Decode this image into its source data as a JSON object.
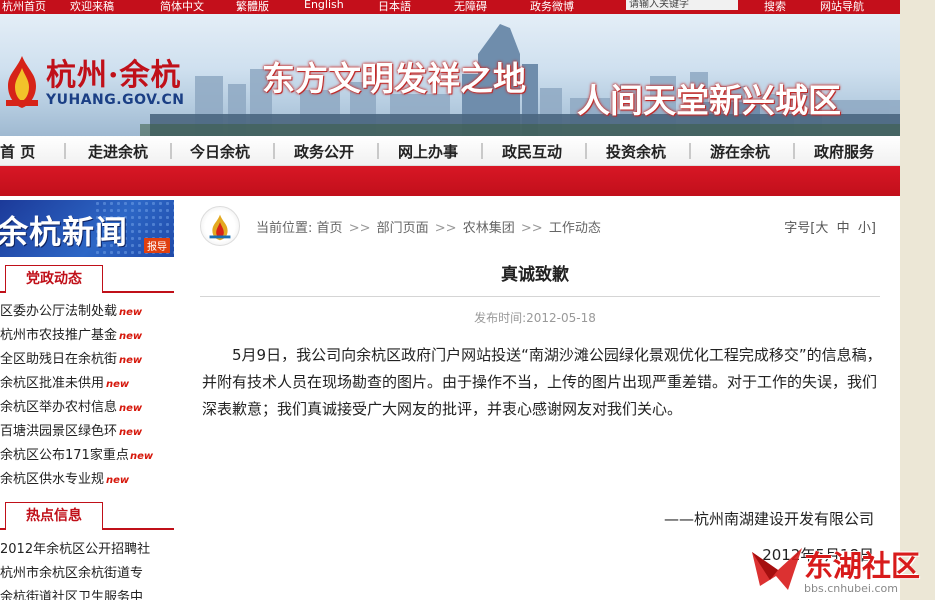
{
  "topbar": {
    "items": [
      "杭州首页",
      "欢迎来稿",
      "简体中文",
      "繁體版",
      "English",
      "日本語",
      "无障碍",
      "政务微博"
    ],
    "search_placeholder": "请输入关键字",
    "right_items": [
      "搜索",
      "网站导航"
    ]
  },
  "banner": {
    "logo_title": "杭州·余杭",
    "logo_sub": "YUHANG.GOV.CN",
    "slogan_1": "东方文明发祥之地",
    "slogan_2": "人间天堂新兴城区"
  },
  "nav": {
    "items": [
      "首 页",
      "走进余杭",
      "今日余杭",
      "政务公开",
      "网上办事",
      "政民互动",
      "投资余杭",
      "游在余杭",
      "政府服务"
    ]
  },
  "sidebar": {
    "news_title": "余杭新闻",
    "news_tag": "报导",
    "sections": [
      {
        "title": "党政动态",
        "items": [
          {
            "text": "区委办公厅法制处载",
            "badge": "new"
          },
          {
            "text": "杭州市农技推广基金",
            "badge": "new"
          },
          {
            "text": "全区助残日在余杭街",
            "badge": "new"
          },
          {
            "text": "余杭区批准未供用",
            "badge": "new"
          },
          {
            "text": "余杭区举办农村信息",
            "badge": "new"
          },
          {
            "text": "百塘洪园景区绿色环",
            "badge": "new"
          },
          {
            "text": "余杭区公布171家重点",
            "badge": "new"
          },
          {
            "text": "余杭区供水专业规",
            "badge": "new"
          }
        ]
      },
      {
        "title": "热点信息",
        "items": [
          {
            "text": "2012年余杭区公开招聘社",
            "badge": ""
          },
          {
            "text": "杭州市余杭区余杭街道专",
            "badge": ""
          },
          {
            "text": "余杭街道社区卫生服务中",
            "badge": ""
          }
        ]
      }
    ]
  },
  "article": {
    "breadcrumb_label": "当前位置:",
    "breadcrumb": [
      "首页",
      "部门页面",
      "农林集团",
      "工作动态"
    ],
    "font_size_label": "字号",
    "font_size_options": [
      "大",
      "中",
      "小"
    ],
    "title": "真诚致歉",
    "date_label": "发布时间:",
    "date": "2012-05-18",
    "body": "5月9日，我公司向余杭区政府门户网站投送“南湖沙滩公园绿化景观优化工程完成移交”的信息稿，并附有技术人员在现场勘查的图片。由于操作不当，上传的图片出现严重差错。对于工作的失误，我们深表歉意；我们真诚接受广大网友的批评，并衷心感谢网友对我们关心。",
    "signature": "——杭州南湖建设开发有限公司",
    "sign_date": "2012年5月18日"
  },
  "watermark": {
    "text": "东湖社区",
    "url": "bbs.cnhubei.com"
  },
  "colors": {
    "brand_red": "#c40f1b",
    "nav_text": "#222222",
    "link_blue": "#1b3f85"
  }
}
